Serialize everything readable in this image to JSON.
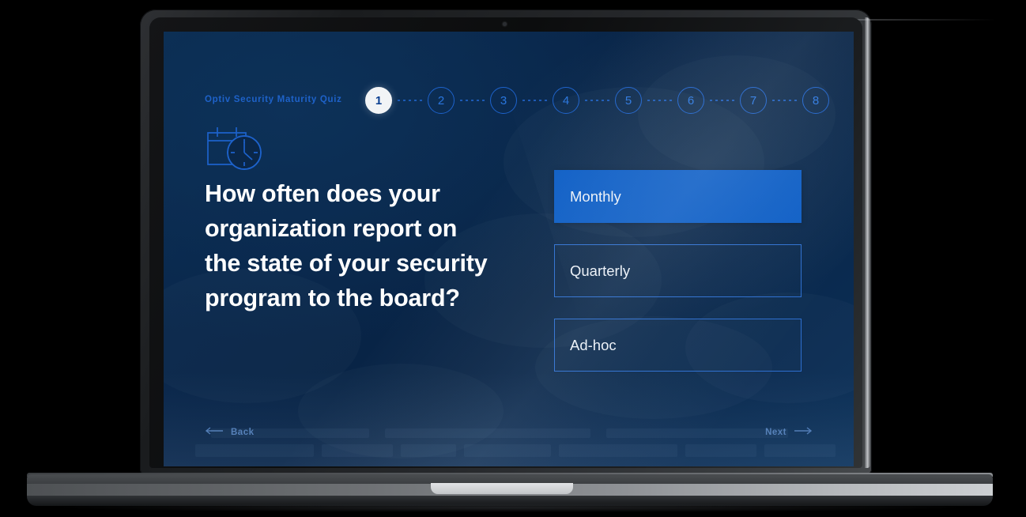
{
  "quiz": {
    "title": "Optiv Security Maturity Quiz",
    "stepper": {
      "steps": [
        "1",
        "2",
        "3",
        "4",
        "5",
        "6",
        "7",
        "8"
      ],
      "active_index": 0
    },
    "icon": {
      "name": "calendar-clock-icon",
      "color": "#1d62cb"
    },
    "question": "How often does your organization report on the state of your security program to the board?",
    "answers": [
      {
        "label": "Monthly",
        "selected": true
      },
      {
        "label": "Quarterly",
        "selected": false
      },
      {
        "label": "Ad-hoc",
        "selected": false
      }
    ],
    "nav": {
      "back_label": "Back",
      "back_icon": "arrow-left-icon",
      "next_label": "Next",
      "next_icon": "arrow-right-icon"
    },
    "colors": {
      "screen_background": "#0a2749",
      "accent_blue": "#0b5cc4",
      "outline_blue": "#2d6fd0",
      "title_blue": "#1e62c9",
      "nav_text": "#4d79b4",
      "answer_text": "#eef2f7",
      "question_text": "#ffffff",
      "active_step_fill": "#f2f4f6",
      "active_step_text": "#0b3f91"
    }
  },
  "device": {
    "name": "laptop-mockup",
    "background": "#000000"
  }
}
